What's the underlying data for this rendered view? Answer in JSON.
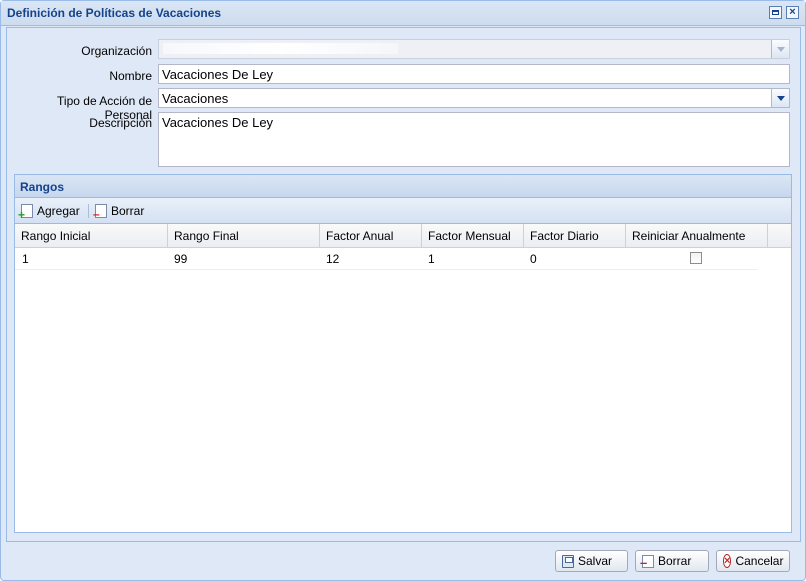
{
  "window": {
    "title": "Definición de Políticas de Vacaciones"
  },
  "form": {
    "organizacion_label": "Organización",
    "organizacion_value": "",
    "nombre_label": "Nombre",
    "nombre_value": "Vacaciones De Ley",
    "tipo_label": "Tipo de Acción de Personal",
    "tipo_value": "Vacaciones",
    "descripcion_label": "Descripción",
    "descripcion_value": "Vacaciones De Ley"
  },
  "rangos": {
    "title": "Rangos",
    "toolbar": {
      "agregar": "Agregar",
      "borrar": "Borrar"
    },
    "columns": [
      "Rango Inicial",
      "Rango Final",
      "Factor Anual",
      "Factor Mensual",
      "Factor Diario",
      "Reiniciar Anualmente"
    ],
    "rows": [
      {
        "rango_inicial": "1",
        "rango_final": "99",
        "factor_anual": "12",
        "factor_mensual": "1",
        "factor_diario": "0",
        "reiniciar_anualmente": false
      }
    ]
  },
  "footer": {
    "salvar": "Salvar",
    "borrar": "Borrar",
    "cancelar": "Cancelar"
  },
  "colors": {
    "title_text": "#15428b",
    "border": "#99bbe8",
    "panel_bg": "#dfe8f6"
  }
}
